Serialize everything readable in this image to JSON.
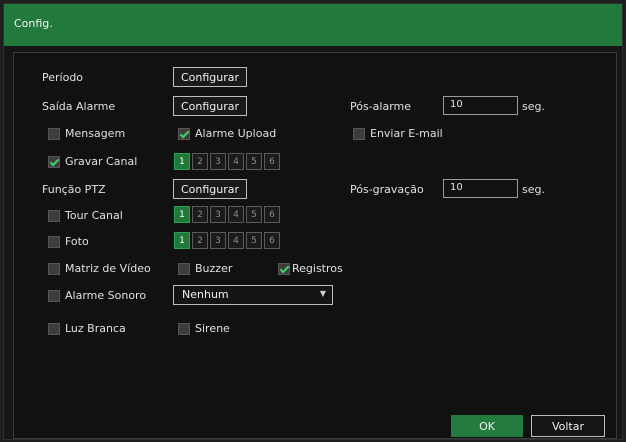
{
  "window": {
    "title": "Config."
  },
  "rows": {
    "periodo": {
      "label": "Período",
      "button": "Configurar"
    },
    "saida_alarme": {
      "label": "Saída Alarme",
      "button": "Configurar"
    },
    "pos_alarme": {
      "label": "Pós-alarme",
      "value": "10",
      "unit": "seg."
    },
    "mensagem": {
      "label": "Mensagem",
      "checked": false
    },
    "alarme_upload": {
      "label": "Alarme Upload",
      "checked": true
    },
    "enviar_email": {
      "label": "Enviar E-mail",
      "checked": false
    },
    "gravar_canal": {
      "label": "Gravar Canal",
      "checked": true,
      "channels": [
        "1",
        "2",
        "3",
        "4",
        "5",
        "6"
      ],
      "selected": [
        "1"
      ]
    },
    "funcao_ptz": {
      "label": "Função PTZ",
      "button": "Configurar"
    },
    "pos_gravacao": {
      "label": "Pós-gravação",
      "value": "10",
      "unit": "seg."
    },
    "tour_canal": {
      "label": "Tour Canal",
      "checked": false,
      "channels": [
        "1",
        "2",
        "3",
        "4",
        "5",
        "6"
      ],
      "selected": [
        "1"
      ]
    },
    "foto": {
      "label": "Foto",
      "checked": false,
      "channels": [
        "1",
        "2",
        "3",
        "4",
        "5",
        "6"
      ],
      "selected": [
        "1"
      ]
    },
    "matriz_video": {
      "label": "Matriz de Vídeo",
      "checked": false
    },
    "buzzer": {
      "label": "Buzzer",
      "checked": false
    },
    "registros": {
      "label": "Registros",
      "checked": true
    },
    "alarme_sonoro": {
      "label": "Alarme Sonoro",
      "checked": false,
      "select_value": "Nenhum"
    },
    "luz_branca": {
      "label": "Luz Branca",
      "checked": false
    },
    "sirene": {
      "label": "Sirene",
      "checked": false
    }
  },
  "footer": {
    "ok_label": "OK",
    "cancel_label": "Voltar"
  },
  "colors": {
    "accent": "#237c3e",
    "check": "#3fd06a"
  }
}
